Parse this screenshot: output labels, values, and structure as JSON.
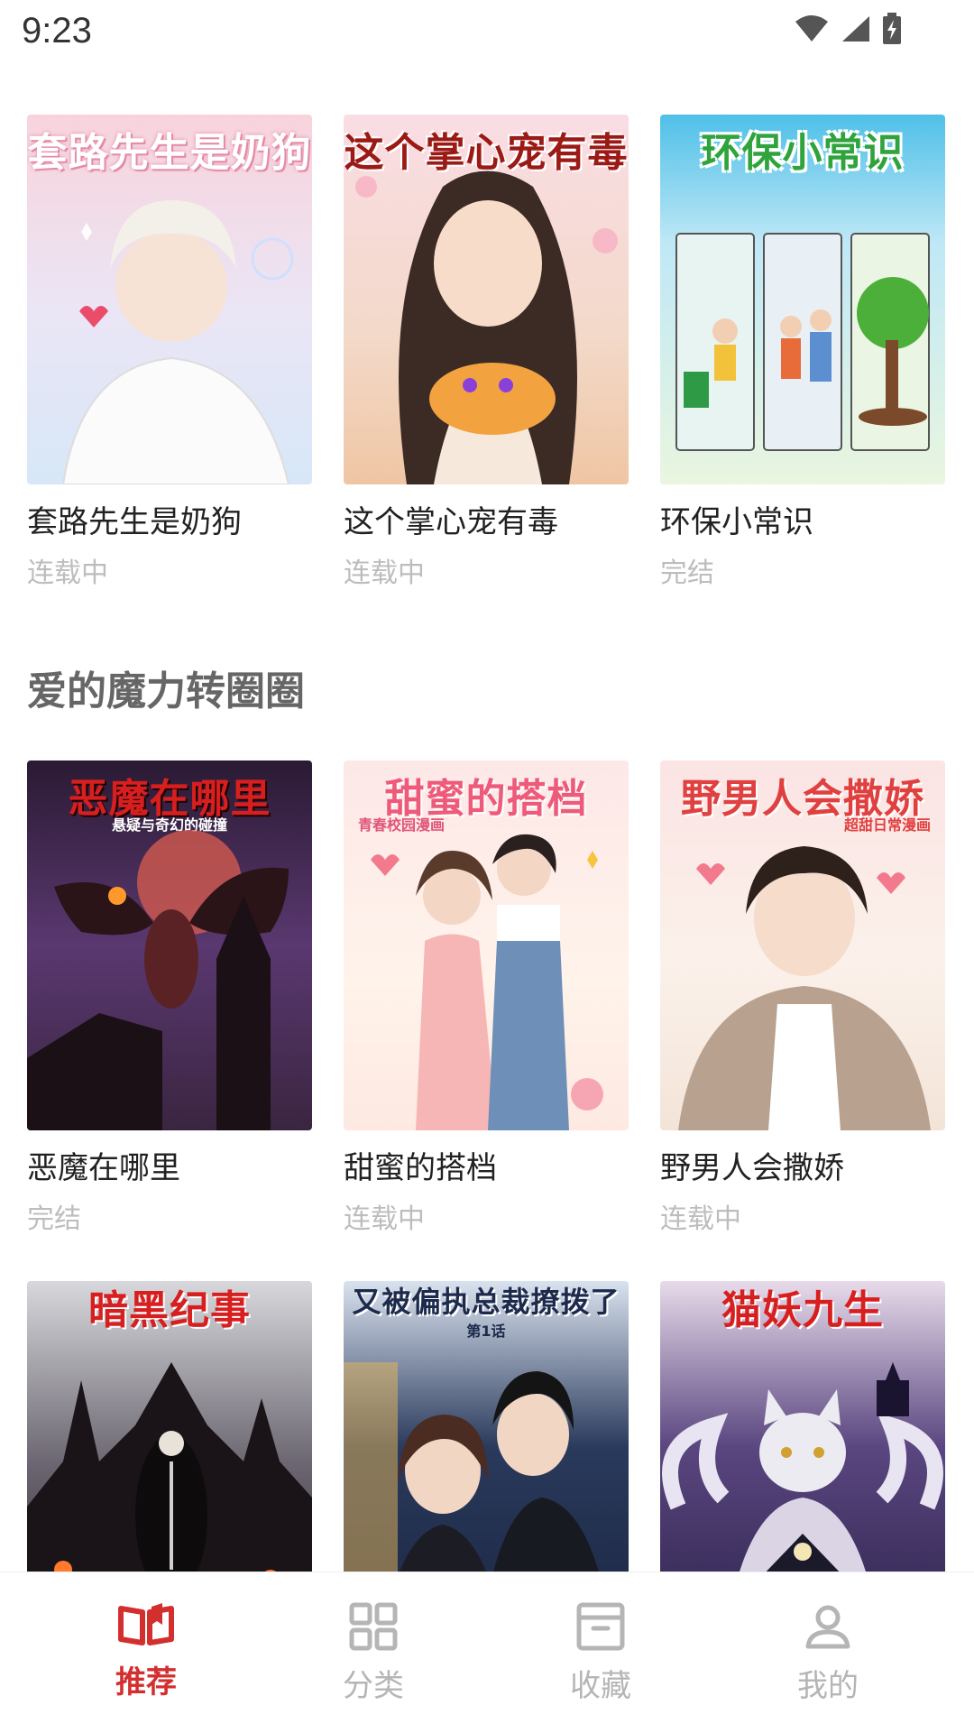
{
  "status_bar": {
    "time": "9:23"
  },
  "sections": [
    {
      "title": ""
    },
    {
      "title": "爱的魔力转圈圈"
    }
  ],
  "cards": [
    {
      "title": "套路先生是奶狗",
      "status": "连载中",
      "cover_title": "套路先生是奶狗",
      "cover_sub": ""
    },
    {
      "title": "这个掌心宠有毒",
      "status": "连载中",
      "cover_title": "这个掌心宠有毒",
      "cover_sub": ""
    },
    {
      "title": "环保小常识",
      "status": "完结",
      "cover_title": "环保小常识",
      "cover_sub": ""
    },
    {
      "title": "恶魔在哪里",
      "status": "完结",
      "cover_title": "恶魔在哪里",
      "cover_sub": "悬疑与奇幻的碰撞"
    },
    {
      "title": "甜蜜的搭档",
      "status": "连载中",
      "cover_title": "甜蜜的搭档",
      "cover_sub": "青春校园漫画"
    },
    {
      "title": "野男人会撒娇",
      "status": "连载中",
      "cover_title": "野男人会撒娇",
      "cover_sub": "超甜日常漫画"
    },
    {
      "title": "",
      "status": "",
      "cover_title": "暗黑纪事",
      "cover_sub": ""
    },
    {
      "title": "",
      "status": "",
      "cover_title": "又被偏执总裁撩拨了",
      "cover_sub": "第1话"
    },
    {
      "title": "",
      "status": "",
      "cover_title": "猫妖九生",
      "cover_sub": ""
    }
  ],
  "bottom_nav": [
    {
      "label": "推荐",
      "icon": "book-open-icon",
      "active": true
    },
    {
      "label": "分类",
      "icon": "grid-icon",
      "active": false
    },
    {
      "label": "收藏",
      "icon": "archive-box-icon",
      "active": false
    },
    {
      "label": "我的",
      "icon": "person-icon",
      "active": false
    }
  ],
  "colors": {
    "accent": "#d32f2f",
    "muted": "#b5b5b5"
  }
}
